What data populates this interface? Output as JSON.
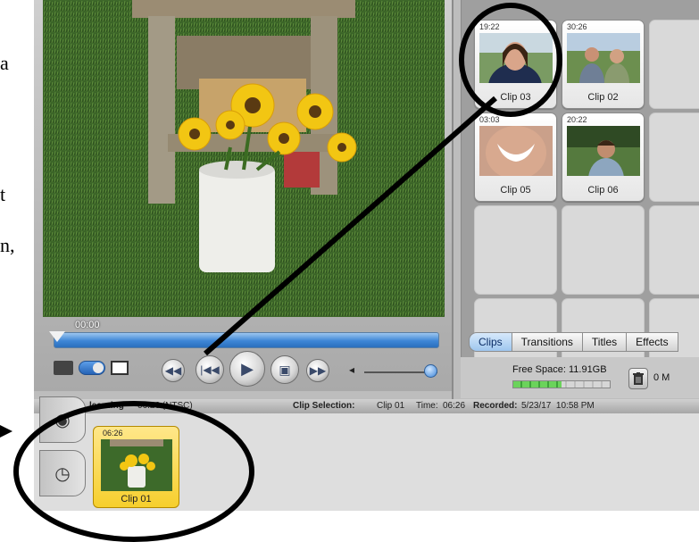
{
  "document": {
    "fragments": [
      "a",
      "t",
      "n,"
    ]
  },
  "monitor": {
    "timecode": "00:00",
    "controls": {
      "camera_mode_icon": "dv-camera-icon",
      "edit_mode_toggle_icon": "toggle-switch-icon",
      "fullscreen_icon": "fullscreen-icon",
      "rewind_icon": "rewind-icon",
      "previous_icon": "skip-back-icon",
      "play_icon": "play-icon",
      "play_full_icon": "play-fullscreen-icon",
      "forward_icon": "fast-forward-icon",
      "volume_low_icon": "volume-low-icon",
      "volume_high_icon": "volume-high-icon",
      "volume_level": 0.9
    }
  },
  "clips_pane": {
    "clips": [
      {
        "name": "Clip 03",
        "duration": "19:22"
      },
      {
        "name": "Clip 02",
        "duration": "30:26"
      },
      {
        "name": "Clip 05",
        "duration": "03:03"
      },
      {
        "name": "Clip 06",
        "duration": "20:22"
      }
    ],
    "tabs": [
      "Clips",
      "Transitions",
      "Titles",
      "Effects"
    ],
    "active_tab": "Clips",
    "free_space": "Free Space: 11.91GB",
    "free_space_used_fraction": 0.5,
    "trash_label": "0 M",
    "trash_icon": "trash-icon"
  },
  "status_bar": {
    "project": "learning",
    "project_time": "06:26 (NTSC)",
    "clip_selection_label": "Clip Selection:",
    "clip_selection_value": "Clip 01",
    "time_label": "Time:",
    "time_value": "06:26",
    "recorded_label": "Recorded:",
    "recorded_value": "5/23/17  10:58 PM"
  },
  "shelf": {
    "clip_viewer_icon": "eye-icon",
    "timeline_viewer_icon": "clock-icon",
    "timeline_clip": {
      "name": "Clip 01",
      "duration": "06:26"
    }
  },
  "colors": {
    "accent_blue": "#3e86d6",
    "selected_clip": "#f6cf2d",
    "annotation": "#000000"
  }
}
